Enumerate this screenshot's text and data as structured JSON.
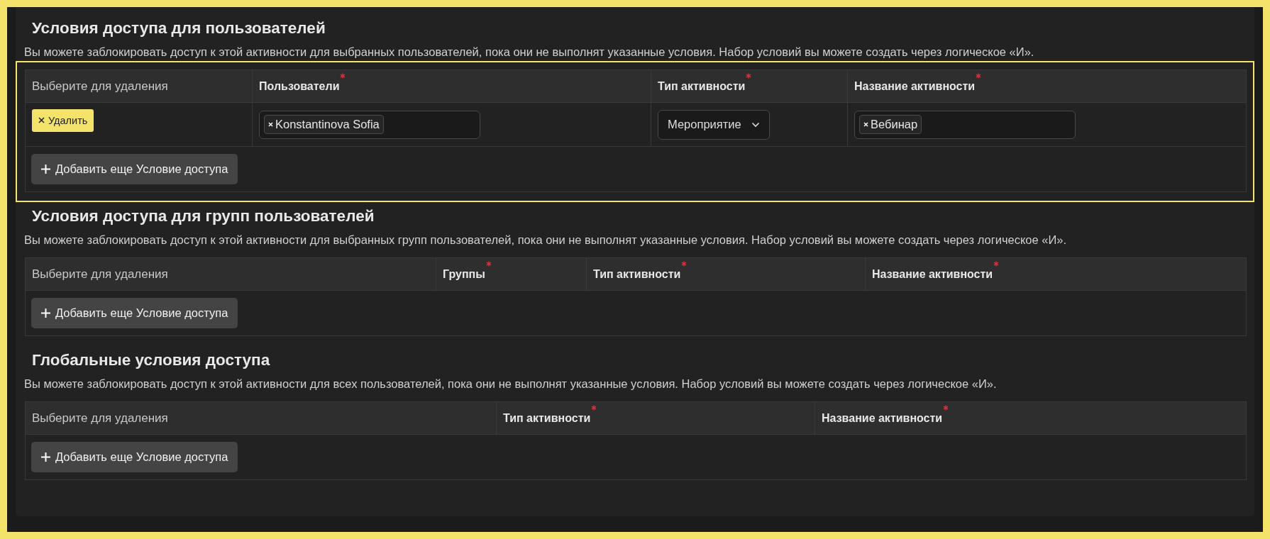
{
  "sections": [
    {
      "title": "Условия доступа для пользователей",
      "description": "Вы можете заблокировать доступ к этой активности для выбранных пользователей, пока они не выполнят указанные условия. Набор условий вы можете создать через логическое «И».",
      "highlighted": true,
      "columns": [
        {
          "label": "Выберите для удаления",
          "required": false
        },
        {
          "label": "Пользователи",
          "required": true
        },
        {
          "label": "Тип активности",
          "required": true
        },
        {
          "label": "Название активности",
          "required": true
        }
      ],
      "rows": [
        {
          "cells": [
            {
              "kind": "delete",
              "label": "Удалить"
            },
            {
              "kind": "tags",
              "tags": [
                "Konstantinova Sofia"
              ]
            },
            {
              "kind": "select",
              "value": "Мероприятие"
            },
            {
              "kind": "tags",
              "tags": [
                "Вебинар"
              ]
            }
          ]
        }
      ],
      "add_button": "Добавить еще Условие доступа"
    },
    {
      "title": "Условия доступа для групп пользователей",
      "description": "Вы можете заблокировать доступ к этой активности для выбранных групп пользователей, пока они не выполнят указанные условия. Набор условий вы можете создать через логическое «И».",
      "highlighted": false,
      "columns": [
        {
          "label": "Выберите для удаления",
          "required": false
        },
        {
          "label": "Группы",
          "required": true
        },
        {
          "label": "Тип активности",
          "required": true
        },
        {
          "label": "Название активности",
          "required": true
        }
      ],
      "add_button": "Добавить еще Условие доступа"
    },
    {
      "title": "Глобальные условия доступа",
      "description": "Вы можете заблокировать доступ к этой активности для всех пользователей, пока они не выполнят указанные условия. Набор условий вы можете создать через логическое «И».",
      "highlighted": false,
      "columns": [
        {
          "label": "Выберите для удаления",
          "required": false
        },
        {
          "label": "Тип активности",
          "required": true
        },
        {
          "label": "Название активности",
          "required": true
        }
      ],
      "add_button": "Добавить еще Условие доступа"
    }
  ]
}
